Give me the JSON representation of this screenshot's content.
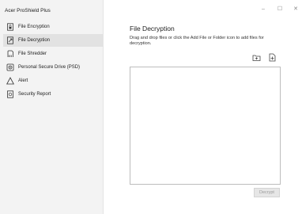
{
  "app": {
    "title": "Acer ProShield Plus"
  },
  "window_controls": {
    "minimize": "–",
    "maximize": "☐",
    "close": "✕"
  },
  "sidebar": {
    "items": [
      {
        "label": "File Encryption",
        "icon": "file-lock-icon",
        "selected": false
      },
      {
        "label": "File Decryption",
        "icon": "file-unlock-icon",
        "selected": true
      },
      {
        "label": "File Shredder",
        "icon": "shredder-icon",
        "selected": false
      },
      {
        "label": "Personal Secure Drive (PSD)",
        "icon": "secure-drive-icon",
        "selected": false
      },
      {
        "label": "Alert",
        "icon": "warning-icon",
        "selected": false
      },
      {
        "label": "Security Report",
        "icon": "report-icon",
        "selected": false
      }
    ]
  },
  "main": {
    "title": "File Decryption",
    "instructions": "Drag and drop files or click the Add File or Folder icon to add files for decryption.",
    "toolbar": {
      "add_folder_icon": "add-folder-icon",
      "add_file_icon": "add-file-icon"
    },
    "decrypt_label": "Decrypt"
  }
}
